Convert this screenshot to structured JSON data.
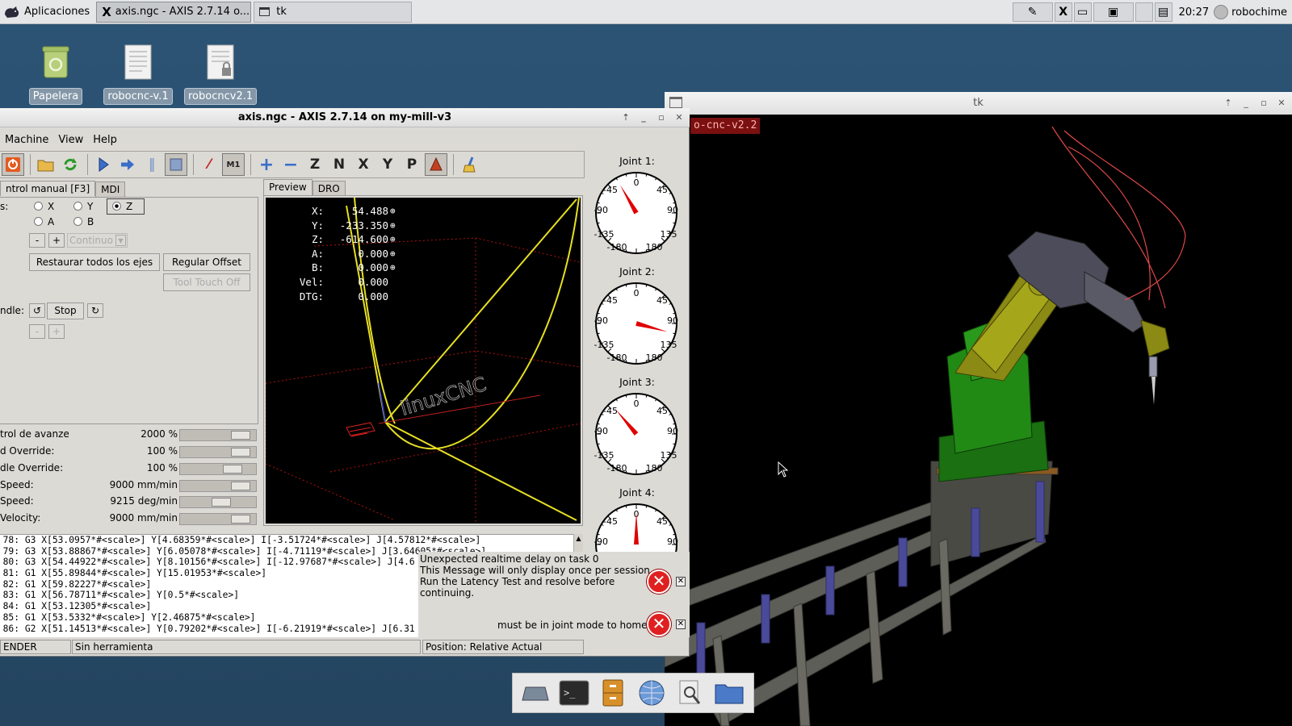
{
  "panel": {
    "apps_label": "Aplicaciones",
    "tasks": [
      {
        "label": "axis.ngc - AXIS 2.7.14 o...",
        "active": true
      },
      {
        "label": "tk",
        "active": false
      }
    ],
    "clock": "20:27",
    "user": "robochime"
  },
  "desktop": {
    "icons": [
      {
        "label": "Papelera",
        "icon": "trash-icon"
      },
      {
        "label": "robocnc-v.1",
        "icon": "document-icon"
      },
      {
        "label": "robocncv2.1",
        "icon": "locked-document-icon"
      }
    ]
  },
  "axis": {
    "title": "axis.ngc - AXIS 2.7.14 on my-mill-v3",
    "menu": [
      "Machine",
      "View",
      "Help"
    ],
    "tabs": {
      "manual": "ntrol manual [F3]",
      "mdi": "MDI"
    },
    "axis_label": "s:",
    "axes": [
      {
        "name": "X",
        "selected": false
      },
      {
        "name": "Y",
        "selected": false
      },
      {
        "name": "Z",
        "selected": true
      },
      {
        "name": "A",
        "selected": false
      },
      {
        "name": "B",
        "selected": false
      }
    ],
    "jog_minus": "-",
    "jog_plus": "+",
    "jog_mode": "Continuo",
    "home_all": "Restaurar todos los ejes",
    "touch_off": "Regular Offset",
    "tool_touch_off": "Tool Touch Off",
    "spindle_label": "ndle:",
    "spindle_stop": "Stop",
    "spindle_minus": "-",
    "spindle_plus": "+",
    "sliders": [
      {
        "label": "trol de avanze",
        "value": "2000 %",
        "level": 0.9
      },
      {
        "label": "d Override:",
        "value": "100 %",
        "level": 0.9
      },
      {
        "label": "dle Override:",
        "value": "100 %",
        "level": 0.75
      },
      {
        "label": "Speed:",
        "value": "9000 mm/min",
        "level": 0.9
      },
      {
        "label": "Speed:",
        "value": "9215 deg/min",
        "level": 0.55
      },
      {
        "label": "Velocity:",
        "value": "9000 mm/min",
        "level": 0.9
      }
    ],
    "preview_tabs": [
      "Preview",
      "DRO"
    ],
    "dro": [
      {
        "k": "X:",
        "v": "54.488",
        "homed": true
      },
      {
        "k": "Y:",
        "v": "-233.350",
        "homed": true
      },
      {
        "k": "Z:",
        "v": "-614.600",
        "homed": true
      },
      {
        "k": "A:",
        "v": "0.000",
        "homed": true
      },
      {
        "k": "B:",
        "v": "0.000",
        "homed": true
      },
      {
        "k": "Vel:",
        "v": "0.000",
        "homed": false
      },
      {
        "k": "DTG:",
        "v": "0.000",
        "homed": false
      }
    ],
    "preview_text": "linuxCNC",
    "joints": [
      {
        "label": "Joint 1:",
        "angle": -30
      },
      {
        "label": "Joint 2:",
        "angle": 105
      },
      {
        "label": "Joint 3:",
        "angle": -40
      },
      {
        "label": "Joint 4:",
        "angle": 0
      }
    ],
    "gauge_ticks": [
      "0",
      "45",
      "-45",
      "90",
      "-90",
      "135",
      "-135",
      "180",
      "-180"
    ],
    "gcode": [
      {
        "n": "78:",
        "t": "G3 X[53.0957*#<scale>] Y[4.68359*#<scale>] I[-3.51724*#<scale>] J[4.57812*#<scale>]"
      },
      {
        "n": "79:",
        "t": "G3 X[53.88867*#<scale>] Y[6.05078*#<scale>] I[-4.71119*#<scale>] J[3.64605*#<scale>]"
      },
      {
        "n": "80:",
        "t": "G3 X[54.44922*#<scale>] Y[8.10156*#<scale>] I[-12.97687*#<scale>] J[4.6"
      },
      {
        "n": "81:",
        "t": "G1 X[55.89844*#<scale>] Y[15.01953*#<scale>]"
      },
      {
        "n": "82:",
        "t": "G1 X[59.82227*#<scale>]"
      },
      {
        "n": "83:",
        "t": "G1 X[56.78711*#<scale>] Y[0.5*#<scale>]"
      },
      {
        "n": "84:",
        "t": "G1 X[53.12305*#<scale>]"
      },
      {
        "n": "85:",
        "t": "G1 X[53.5332*#<scale>] Y[2.46875*#<scale>]"
      },
      {
        "n": "86:",
        "t": "G2 X[51.14513*#<scale>] Y[0.79202*#<scale>] I[-6.21919*#<scale>] J[6.31"
      }
    ],
    "error1": [
      "Unexpected realtime delay on task 0",
      "This Message will only display once per session.",
      "Run the Latency Test and resolve before",
      "continuing."
    ],
    "error2": "must be in joint mode to home",
    "status": {
      "state": "ENDER",
      "tool": "Sin herramienta",
      "position": "Position: Relative Actual"
    }
  },
  "tk": {
    "title": "tk",
    "label": "o-cnc-v2.2"
  },
  "colors": {
    "desktop": "#284b6a",
    "toolpath": "#e8e020",
    "limits": "#c01818",
    "robot_base": "#1d7a12",
    "robot_arm": "#8a8a14",
    "robot_head": "#4c4c5a",
    "rail": "#565650"
  }
}
